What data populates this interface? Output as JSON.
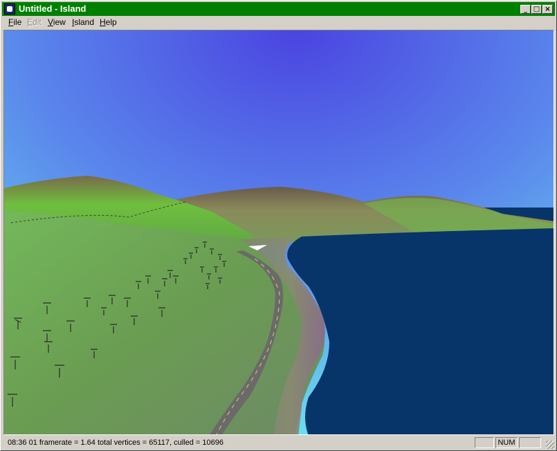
{
  "window": {
    "title": "Untitled - Island",
    "controls": {
      "minimize": "_",
      "maximize": "□",
      "close": "×"
    }
  },
  "menu": {
    "items": [
      {
        "label": "File",
        "mnemonic": "F",
        "rest": "ile",
        "enabled": true
      },
      {
        "label": "Edit",
        "mnemonic": "E",
        "rest": "dit",
        "enabled": false
      },
      {
        "label": "View",
        "mnemonic": "V",
        "rest": "iew",
        "enabled": true
      },
      {
        "label": "Island",
        "mnemonic": "I",
        "rest": "sland",
        "enabled": true
      },
      {
        "label": "Help",
        "mnemonic": "H",
        "rest": "elp",
        "enabled": true
      }
    ]
  },
  "status": {
    "text": "08:36  01 framerate =  1.64  total vertices = 65117,  culled = 10696",
    "panels": {
      "caps": "",
      "num": "NUM",
      "scroll": ""
    }
  },
  "colors": {
    "titlebar": "#008000",
    "sky_top": "#4a44e0",
    "sky_bottom": "#6cf0f0",
    "sea": "#07356a",
    "grass": "#6a9c52",
    "road": "#6a6a6a"
  },
  "icons": {
    "app": "island-app-icon",
    "resize": "size-grip-icon"
  }
}
